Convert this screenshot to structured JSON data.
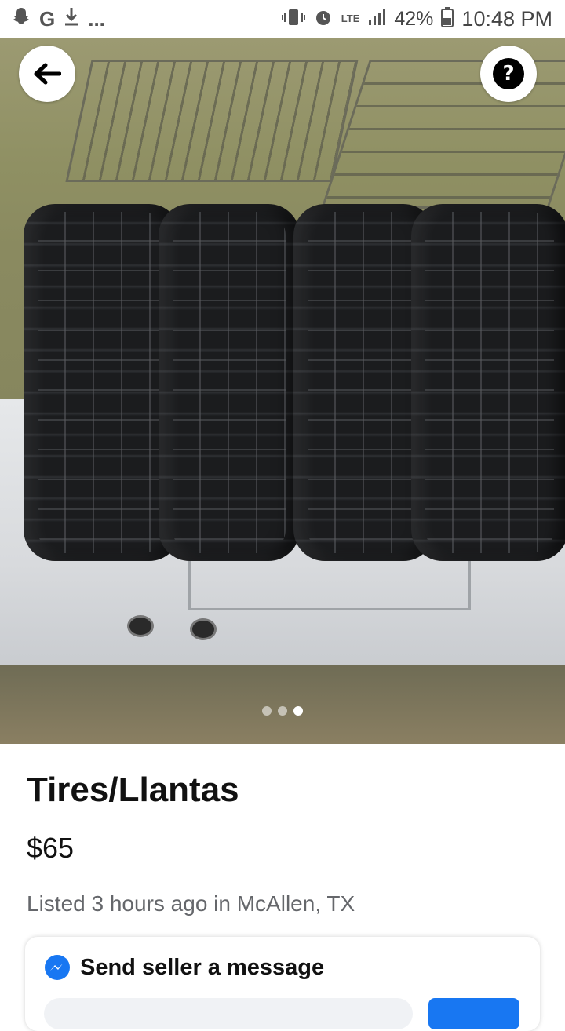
{
  "statusbar": {
    "notifications": [
      "snapchat-icon",
      "google-icon",
      "download-icon"
    ],
    "overflow": "...",
    "lte": "LTE",
    "battery": "42%",
    "time": "10:48 PM"
  },
  "nav": {
    "back_icon": "arrow-left-icon",
    "help_icon": "question-mark-icon",
    "help_glyph": "?"
  },
  "photo": {
    "pages": 3,
    "active_page": 3
  },
  "listing": {
    "title": "Tires/Llantas",
    "price": "$65",
    "listed": "Listed 3 hours ago in McAllen, TX"
  },
  "message_card": {
    "title": "Send seller a message",
    "icon": "messenger-icon",
    "accent": "#1877f2"
  }
}
